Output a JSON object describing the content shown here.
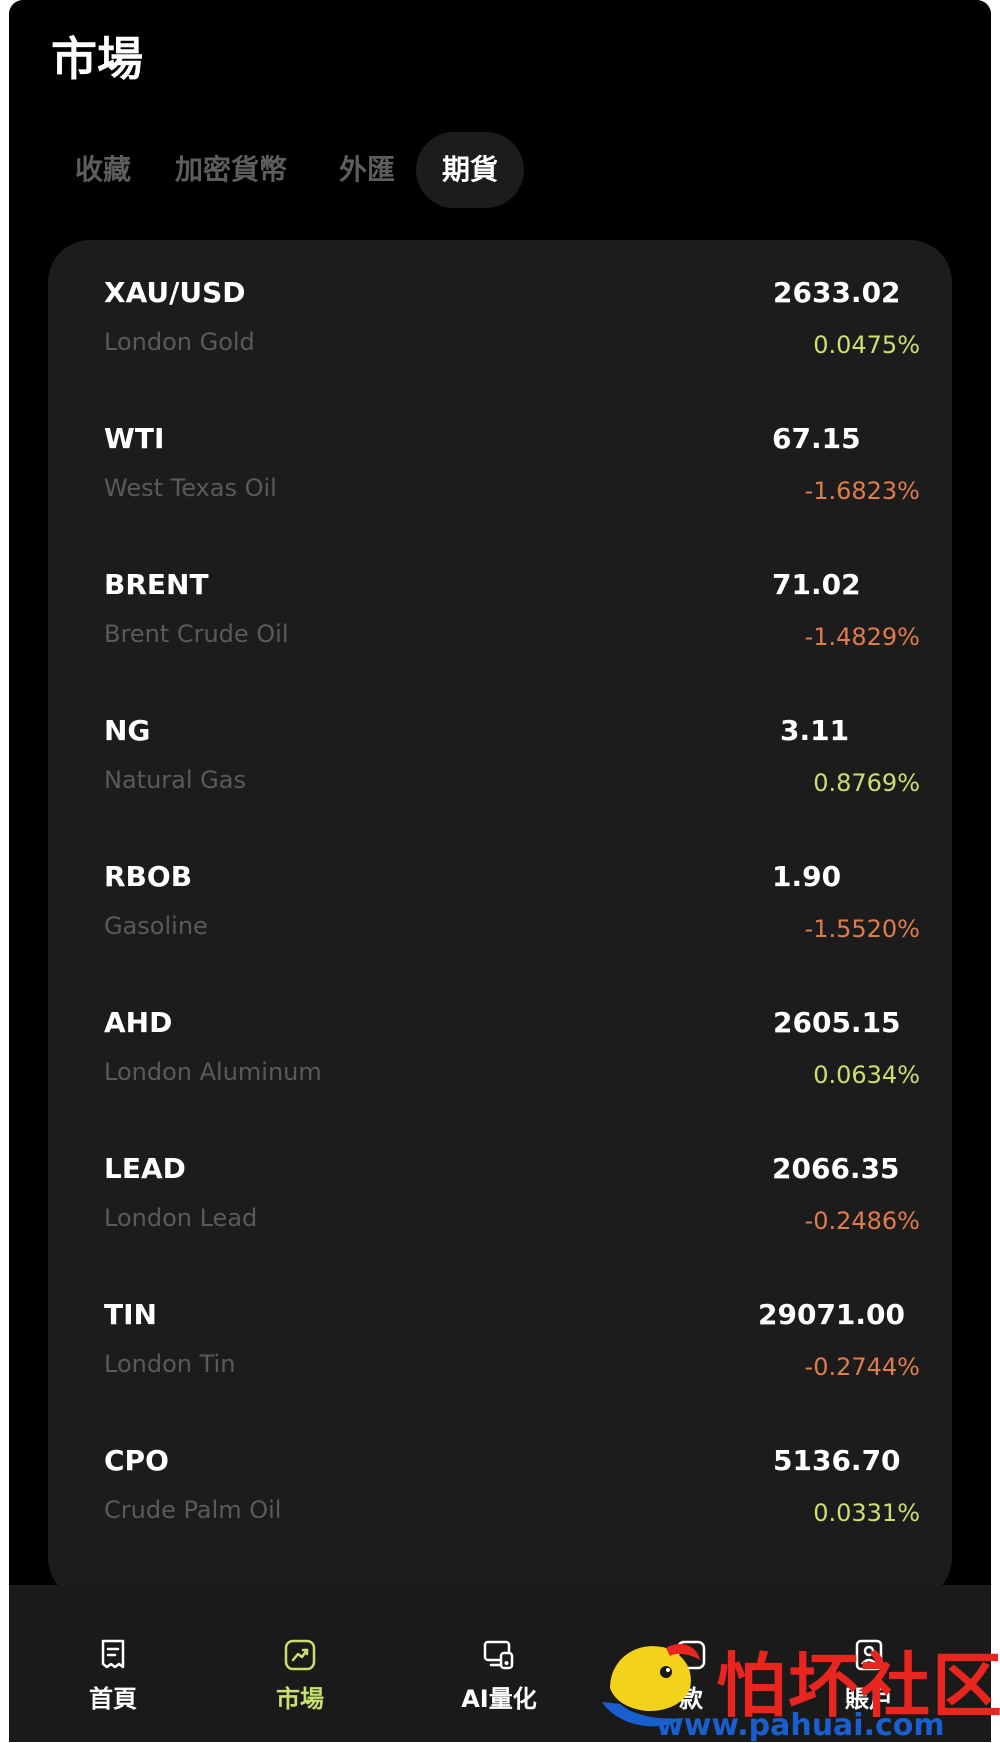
{
  "header": {
    "title": "市場"
  },
  "tabs": [
    {
      "label": "收藏",
      "active": false
    },
    {
      "label": "加密貨幣",
      "active": false
    },
    {
      "label": "外匯",
      "active": false
    },
    {
      "label": "期貨",
      "active": true
    }
  ],
  "colors": {
    "up": "#c8e06e",
    "down": "#e07c4c",
    "accent": "#c8e06e",
    "background": "#000000",
    "card": "#1c1c1c"
  },
  "quotes": [
    {
      "symbol": "XAU/USD",
      "name": "London Gold",
      "price": "2633.02",
      "change": "0.0475%",
      "direction": "up"
    },
    {
      "symbol": "WTI",
      "name": "West Texas Oil",
      "price": "67.15",
      "change": "-1.6823%",
      "direction": "down"
    },
    {
      "symbol": "BRENT",
      "name": "Brent Crude Oil",
      "price": "71.02",
      "change": "-1.4829%",
      "direction": "down"
    },
    {
      "symbol": "NG",
      "name": "Natural Gas",
      "price": "3.11",
      "change": "0.8769%",
      "direction": "up"
    },
    {
      "symbol": "RBOB",
      "name": "Gasoline",
      "price": "1.90",
      "change": "-1.5520%",
      "direction": "down"
    },
    {
      "symbol": "AHD",
      "name": "London Aluminum",
      "price": "2605.15",
      "change": "0.0634%",
      "direction": "up"
    },
    {
      "symbol": "LEAD",
      "name": "London Lead",
      "price": "2066.35",
      "change": "-0.2486%",
      "direction": "down"
    },
    {
      "symbol": "TIN",
      "name": "London Tin",
      "price": "29071.00",
      "change": "-0.2744%",
      "direction": "down"
    },
    {
      "symbol": "CPO",
      "name": "Crude Palm Oil",
      "price": "5136.70",
      "change": "0.0331%",
      "direction": "up"
    }
  ],
  "bottom_nav": [
    {
      "label": "首頁",
      "icon": "receipt-icon",
      "active": false
    },
    {
      "label": "市場",
      "icon": "chart-trend-icon",
      "active": true
    },
    {
      "label": "AI量化",
      "icon": "ai-quant-icon",
      "active": false
    },
    {
      "label": "款",
      "icon": "deposit-icon",
      "active": false
    },
    {
      "label": "賬戶",
      "icon": "account-icon",
      "active": false
    }
  ],
  "watermark": {
    "text": "怕坏社区",
    "url": "www.pahuai.com"
  }
}
